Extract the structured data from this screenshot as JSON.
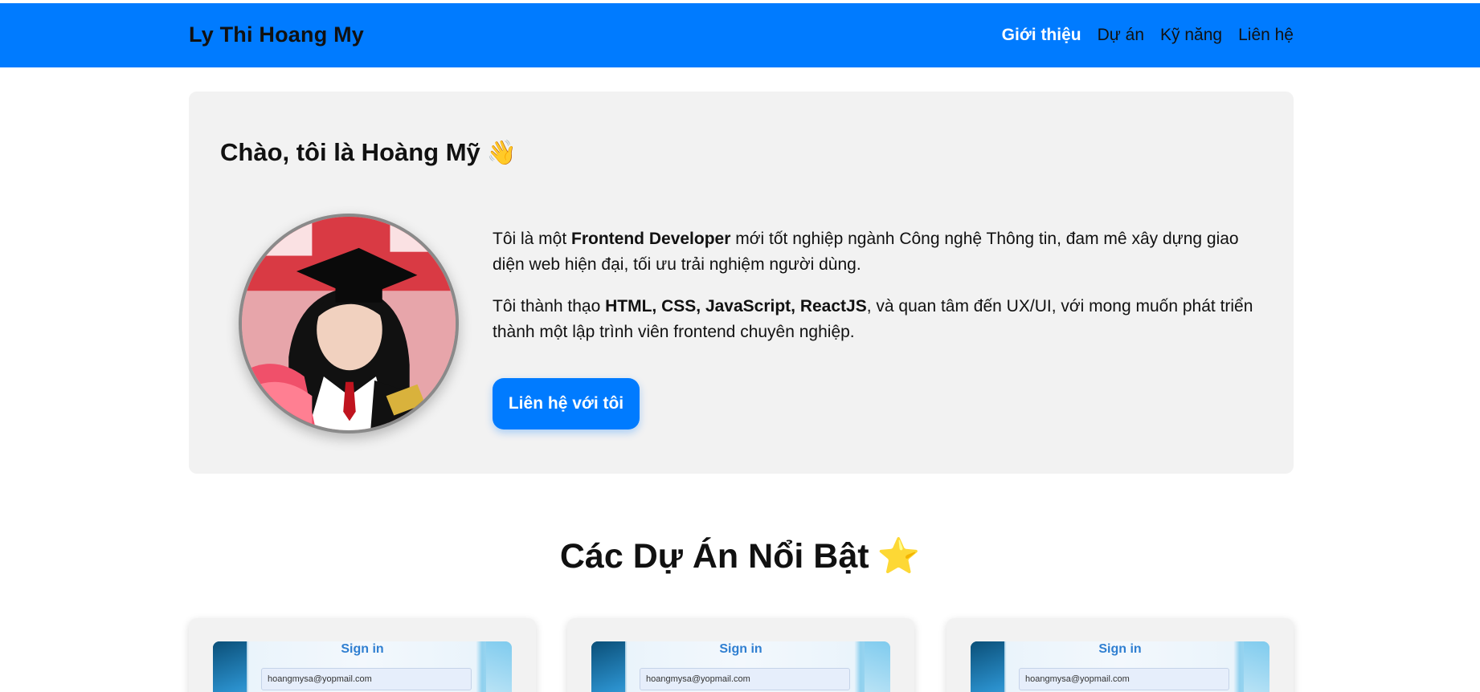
{
  "header": {
    "brand": "Ly Thi Hoang My",
    "nav": [
      {
        "label": "Giới thiệu",
        "active": true
      },
      {
        "label": "Dự án",
        "active": false
      },
      {
        "label": "Kỹ năng",
        "active": false
      },
      {
        "label": "Liên hệ",
        "active": false
      }
    ],
    "color": "#007bff"
  },
  "hero": {
    "title": "Chào, tôi là Hoàng Mỹ",
    "title_emoji": "👋",
    "avatar_icon": "graduate-portrait",
    "p1_a": "Tôi là một ",
    "p1_b": "Frontend Developer",
    "p1_c": " mới tốt nghiệp ngành Công nghệ Thông tin, đam mê xây dựng giao diện web hiện đại, tối ưu trải nghiệm người dùng.",
    "p2_a": "Tôi thành thạo ",
    "p2_b": "HTML, CSS, JavaScript, ReactJS",
    "p2_c": ", và quan tâm đến UX/UI, với mong muốn phát triển thành một lập trình viên frontend chuyên nghiệp.",
    "cta_label": "Liên hệ với tôi"
  },
  "projects": {
    "title": "Các Dự Án Nổi Bật",
    "title_emoji": "⭐",
    "cards": [
      {
        "thumb_title": "Sign in",
        "thumb_email": "hoangmysa@yopmail.com"
      },
      {
        "thumb_title": "Sign in",
        "thumb_email": "hoangmysa@yopmail.com"
      },
      {
        "thumb_title": "Sign in",
        "thumb_email": "hoangmysa@yopmail.com"
      }
    ]
  }
}
